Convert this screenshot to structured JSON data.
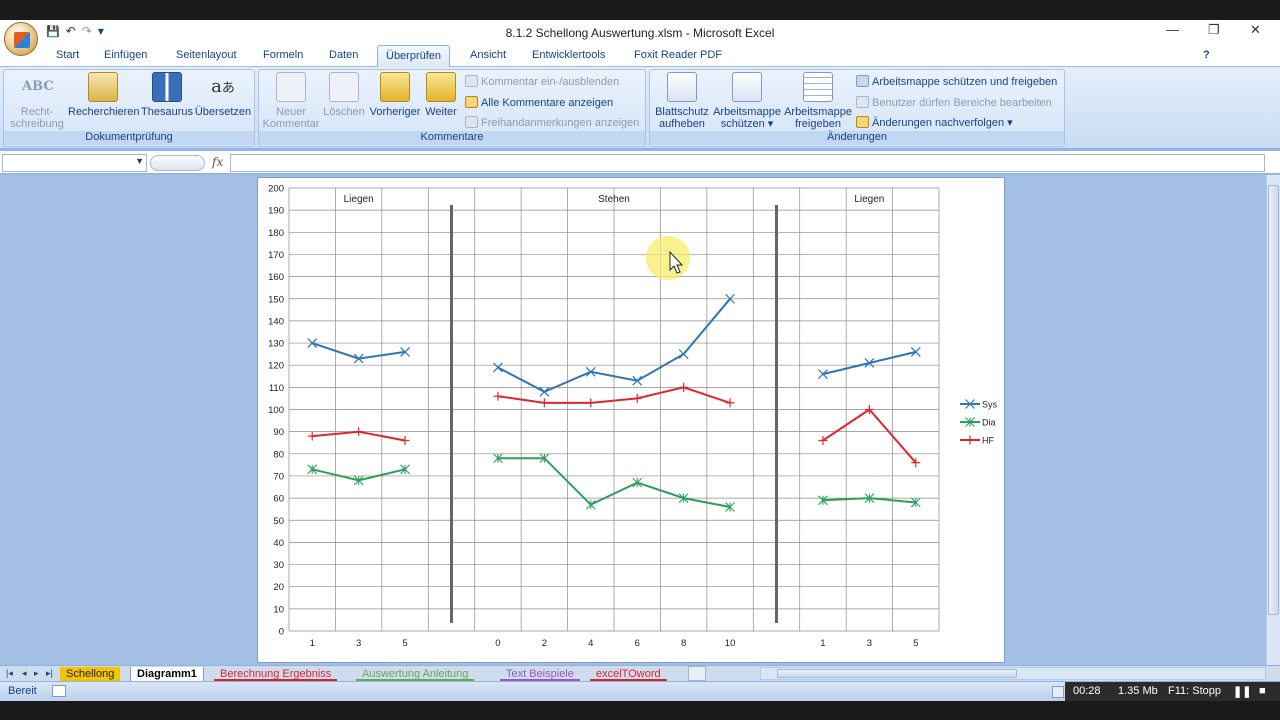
{
  "window": {
    "title": "8.1.2 Schellong Auswertung.xlsm - Microsoft Excel",
    "controls": [
      "—",
      "❐",
      "✕"
    ]
  },
  "qat": {
    "save": "💾",
    "undo": "↶",
    "redo": "↷",
    "more": "▾"
  },
  "tabs": [
    "Start",
    "Einfügen",
    "Seitenlayout",
    "Formeln",
    "Daten",
    "Überprüfen",
    "Ansicht",
    "Entwicklertools",
    "Foxit Reader PDF"
  ],
  "active_tab": "Überprüfen",
  "ribbon": {
    "dokumentpruefung": {
      "label": "Dokumentprüfung",
      "buttons": [
        "Recht-\nschreibung",
        "Recherchieren",
        "Thesaurus",
        "Übersetzen"
      ]
    },
    "kommentare": {
      "label": "Kommentare",
      "buttons": [
        "Neuer\nKommentar",
        "Löschen",
        "Vorheriger",
        "Weiter"
      ],
      "small": [
        "Kommentar ein-/ausblenden",
        "Alle Kommentare anzeigen",
        "Freihandanmerkungen anzeigen"
      ]
    },
    "aenderungen": {
      "label": "Änderungen",
      "buttons": [
        "Blattschutz\naufheben",
        "Arbeitsmappe\nschützen ▾",
        "Arbeitsmappe\nfreigeben"
      ],
      "small": [
        "Arbeitsmappe schützen und freigeben",
        "Benutzer dürfen Bereiche bearbeiten",
        "Änderungen nachverfolgen ▾"
      ]
    }
  },
  "formula_bar": {
    "fx": "fx",
    "name_box": "",
    "formula": ""
  },
  "chart_data": {
    "type": "line",
    "y_axis": {
      "min": 0,
      "max": 200,
      "step": 10
    },
    "grid": true,
    "legend": {
      "position": "right",
      "entries": [
        "Sys",
        "Dia",
        "HF"
      ]
    },
    "colors": {
      "Sys": "#2e75b6",
      "Dia": "#2ca05a",
      "HF": "#e0262b"
    },
    "panels": [
      {
        "label": "Liegen",
        "x": [
          1,
          3,
          5
        ],
        "series": {
          "Sys": [
            130,
            123,
            126
          ],
          "Dia": [
            73,
            68,
            73
          ],
          "HF": [
            88,
            90,
            86
          ]
        }
      },
      {
        "label": "Stehen",
        "x": [
          0,
          2,
          4,
          6,
          8,
          10
        ],
        "series": {
          "Sys": [
            119,
            108,
            117,
            113,
            125,
            150
          ],
          "Dia": [
            78,
            78,
            57,
            67,
            60,
            56
          ],
          "HF": [
            106,
            103,
            103,
            105,
            110,
            103
          ]
        }
      },
      {
        "label": "Liegen",
        "x": [
          1,
          3,
          5
        ],
        "series": {
          "Sys": [
            116,
            121,
            126
          ],
          "Dia": [
            59,
            60,
            58
          ],
          "HF": [
            86,
            100,
            76
          ]
        }
      }
    ]
  },
  "sheet_tabs": [
    {
      "label": "Schellong",
      "color": "#f5c400"
    },
    {
      "label": "Diagramm1",
      "color": "#ffffff",
      "active": true
    },
    {
      "label": "Berechnung Ergebniss",
      "color": "#d9262b"
    },
    {
      "label": "Auswertung Anleitung",
      "color": "#6aa84f"
    },
    {
      "label": "Text Beispiele",
      "color": "#9b59b6"
    },
    {
      "label": "excelTOword",
      "color": "#d9262b"
    }
  ],
  "status": {
    "ready": "Bereit",
    "time": "00:28",
    "size": "1.35 Mb",
    "hint": "F11: Stopp"
  }
}
